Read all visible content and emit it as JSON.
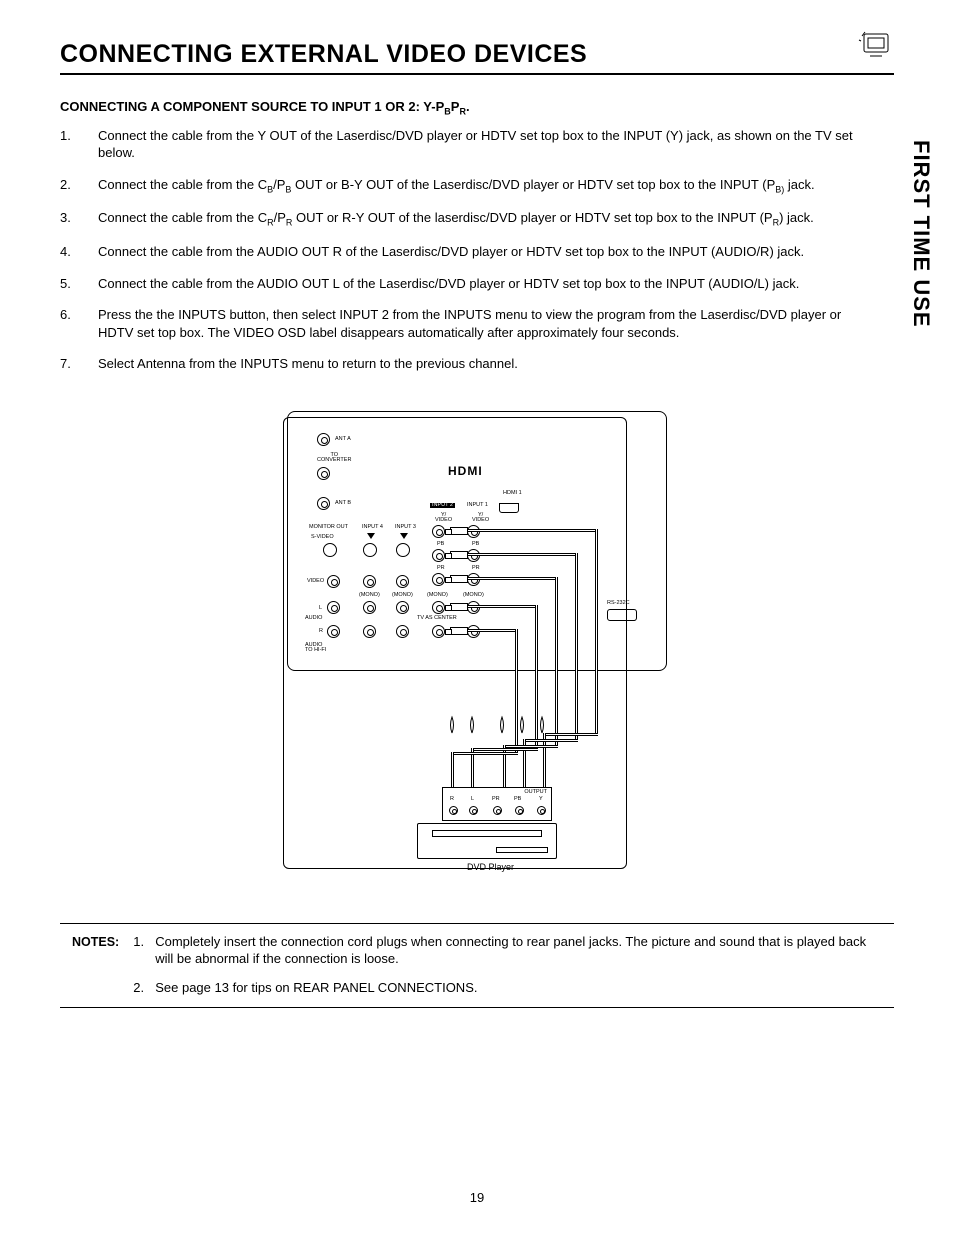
{
  "title": "CONNECTING EXTERNAL VIDEO DEVICES",
  "side_tab": "FIRST TIME USE",
  "subheading_prefix": "CONNECTING A COMPONENT SOURCE TO INPUT 1 OR 2:  Y-P",
  "subheading_sub1": "B",
  "subheading_mid": "P",
  "subheading_sub2": "R",
  "subheading_suffix": ".",
  "steps": [
    {
      "n": "1.",
      "t": "Connect the cable from the Y OUT of the Laserdisc/DVD player or HDTV set top box to the INPUT (Y) jack, as shown on the TV set below."
    },
    {
      "n": "2.",
      "t": "Connect the cable from the C",
      "sub1": "B",
      "t2": "/P",
      "sub2": "B",
      "t3": " OUT or B-Y OUT of the Laserdisc/DVD  player or HDTV set top box to the INPUT (P",
      "sub3": "B)",
      "t4": " jack."
    },
    {
      "n": "3.",
      "t": "Connect the cable from the C",
      "sub1": "R",
      "t2": "/P",
      "sub2": "R",
      "t3": " OUT or R-Y OUT of the laserdisc/DVD player or HDTV set top box to the INPUT (P",
      "sub3": "R",
      "t4": ") jack."
    },
    {
      "n": "4.",
      "t": "Connect the cable from the AUDIO OUT R of the Laserdisc/DVD player or  HDTV set top box to the INPUT (AUDIO/R) jack."
    },
    {
      "n": "5.",
      "t": "Connect the cable from the AUDIO OUT L of the Laserdisc/DVD player or HDTV set top box to the INPUT (AUDIO/L) jack."
    },
    {
      "n": "6.",
      "t": "Press the the INPUTS button, then select INPUT 2 from the INPUTS menu to view the program from the Laserdisc/DVD player or HDTV set top box.  The VIDEO OSD label disappears automatically after approximately four seconds."
    },
    {
      "n": "7.",
      "t": "Select Antenna from the INPUTS menu to return to the previous channel."
    }
  ],
  "diagram": {
    "ant_a": "ANT A",
    "to_conv": "TO\nCONVERTER",
    "ant_b": "ANT B",
    "hdmi": "HDMI",
    "hdmi1": "HDMI 1",
    "monitor_out": "MONITOR OUT",
    "input4": "INPUT 4",
    "input3": "INPUT 3",
    "input2": "INPUT 2",
    "input1": "INPUT 1",
    "svideo": "S-VIDEO",
    "video": "VIDEO",
    "yvideo": "Y/\nVIDEO",
    "pb": "PB",
    "pr": "PR",
    "mono": "(MONO)",
    "l": "L",
    "r": "R",
    "audio": "AUDIO",
    "audio_hifi": "AUDIO\nTO HI-FI",
    "tv_center": "TV AS CENTER",
    "rs232": "RS-232C",
    "output": "OUTPUT",
    "out_labels": [
      "R",
      "L",
      "PR",
      "PB",
      "Y"
    ],
    "dvd": "DVD Player"
  },
  "notes_label": "NOTES:",
  "notes": [
    {
      "n": "1.",
      "t": "Completely insert the connection cord plugs when connecting to rear panel jacks.  The picture and sound that is played back will be abnormal if the connection is loose."
    },
    {
      "n": "2.",
      "t": "See page 13 for tips on REAR PANEL CONNECTIONS."
    }
  ],
  "page_number": "19"
}
